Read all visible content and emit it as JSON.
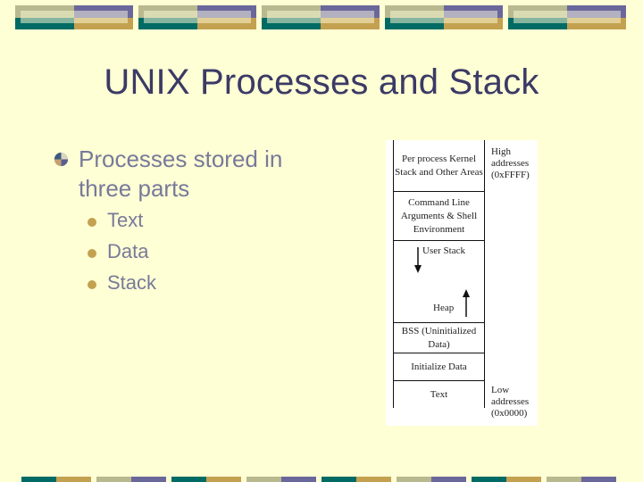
{
  "slide": {
    "title": "UNIX Processes and Stack",
    "colors": {
      "background": "#ffffd5",
      "title": "#3b3a66",
      "body_text": "#777a99",
      "accent_teal": "#006b64",
      "accent_gold": "#c4a150",
      "accent_khaki": "#b9b98f",
      "accent_purple": "#6a689b"
    },
    "main_bullet": {
      "icon": "quartered-circle-bullet-icon",
      "text": "Processes stored in three parts"
    },
    "sub_bullets": [
      {
        "icon": "dot-bullet-icon",
        "text": "Text"
      },
      {
        "icon": "dot-bullet-icon",
        "text": "Data"
      },
      {
        "icon": "dot-bullet-icon",
        "text": "Stack"
      }
    ]
  },
  "memory_diagram": {
    "segments": [
      {
        "label": "Per process Kernel Stack and Other Areas"
      },
      {
        "label": "Command Line Arguments & Shell Environment"
      },
      {
        "label": "User Stack",
        "arrow": "down-arrow-icon"
      },
      {
        "label": "Heap",
        "arrow": "up-arrow-icon"
      },
      {
        "label": "BSS (Uninitialized Data)"
      },
      {
        "label": "Initialize Data"
      },
      {
        "label": "Text"
      }
    ],
    "high_address": {
      "line1": "High",
      "line2": "addresses",
      "line3": "(0xFFFF)"
    },
    "low_address": {
      "line1": "Low",
      "line2": "addresses",
      "line3": "(0x0000)"
    }
  }
}
